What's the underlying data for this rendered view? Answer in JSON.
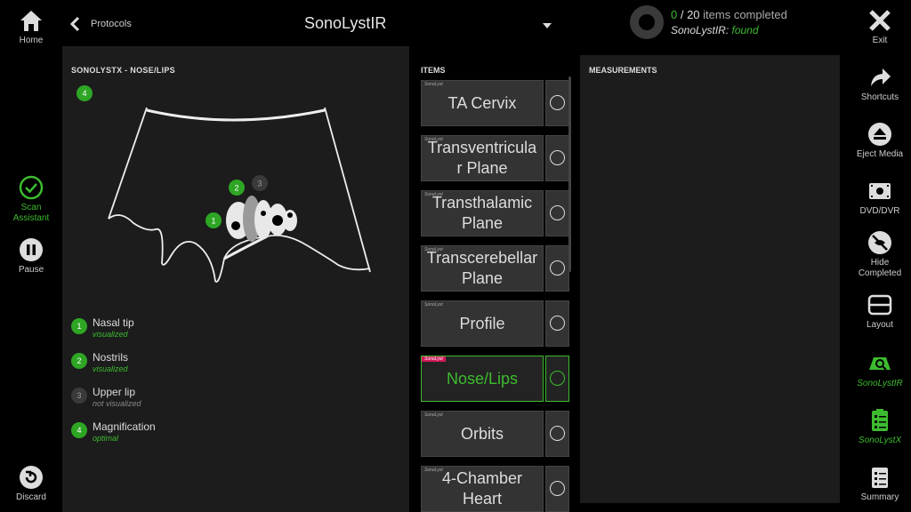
{
  "left_sidebar": {
    "home": "Home",
    "scan_assistant": "Scan\nAssistant",
    "pause": "Pause",
    "discard": "Discard"
  },
  "right_sidebar": {
    "exit": "Exit",
    "shortcuts": "Shortcuts",
    "eject_media": "Eject Media",
    "dvd": "DVD/DVR",
    "hide_completed": "Hide\nCompleted",
    "layout": "Layout",
    "sonolystir": "SonoLystIR",
    "sonolystx": "SonoLystX",
    "summary": "Summary"
  },
  "topbar": {
    "back_label": "Protocols",
    "title": "SonoLystIR",
    "progress_done": "0",
    "progress_total": " / 20",
    "progress_suffix": " items completed",
    "status_label": "SonoLystIR: ",
    "status_value": "found"
  },
  "left_panel": {
    "heading": "SONOLYSTX - NOSE/LIPS",
    "magnification_badge": "4",
    "diagram_markers": [
      "1",
      "2",
      "3"
    ],
    "legend": [
      {
        "num": "1",
        "title": "Nasal tip",
        "status": "visualized",
        "ok": true
      },
      {
        "num": "2",
        "title": "Nostrils",
        "status": "visualized",
        "ok": true
      },
      {
        "num": "3",
        "title": "Upper lip",
        "status": "not visualized",
        "ok": false
      },
      {
        "num": "4",
        "title": "Magnification",
        "status": "optimal",
        "ok": true
      }
    ]
  },
  "items": {
    "heading": "ITEMS",
    "list": [
      {
        "tag": "SonoLyst",
        "name": "TA Cervix",
        "active": false
      },
      {
        "tag": "SonoLyst",
        "name": "Transventricula\nr Plane",
        "active": false
      },
      {
        "tag": "SonoLyst",
        "name": "Transthalamic\nPlane",
        "active": false
      },
      {
        "tag": "SonoLyst",
        "name": "Transcerebellar\nPlane",
        "active": false
      },
      {
        "tag": "SonoLyst",
        "name": "Profile",
        "active": false
      },
      {
        "tag": "SonoLyst",
        "name": "Nose/Lips",
        "active": true
      },
      {
        "tag": "SonoLyst",
        "name": "Orbits",
        "active": false
      },
      {
        "tag": "SonoLyst",
        "name": "4-Chamber\nHeart",
        "active": false
      }
    ]
  },
  "measurements": {
    "heading": "MEASUREMENTS"
  },
  "colors": {
    "accent": "#3dbb2f",
    "tag_active": "#d1185a",
    "panel": "#1c1c1c"
  }
}
